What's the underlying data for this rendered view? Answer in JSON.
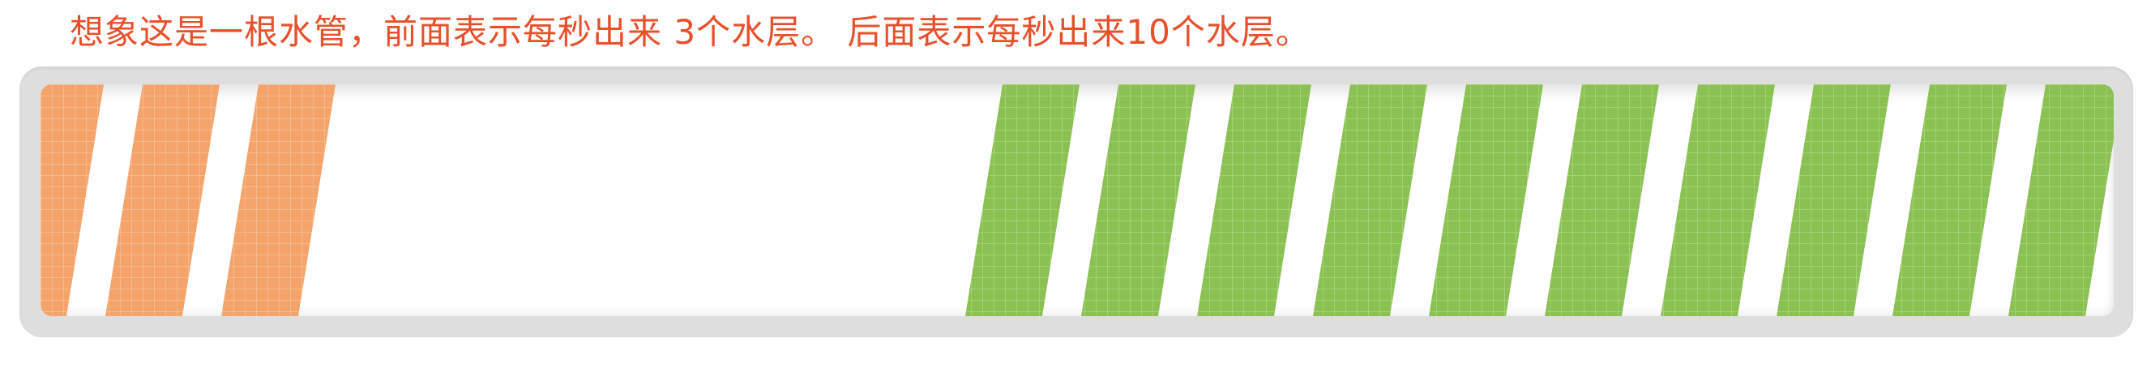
{
  "caption": "想象这是一根水管，前面表示每秒出来 3个水层。 后面表示每秒出来10个水层。",
  "pipe": {
    "left_group": {
      "count": 3,
      "color": "#f4a46a",
      "grid_color": "#f8c7a2"
    },
    "right_group": {
      "count": 10,
      "color": "#8bc152",
      "grid_color": "#b2d98a"
    }
  }
}
